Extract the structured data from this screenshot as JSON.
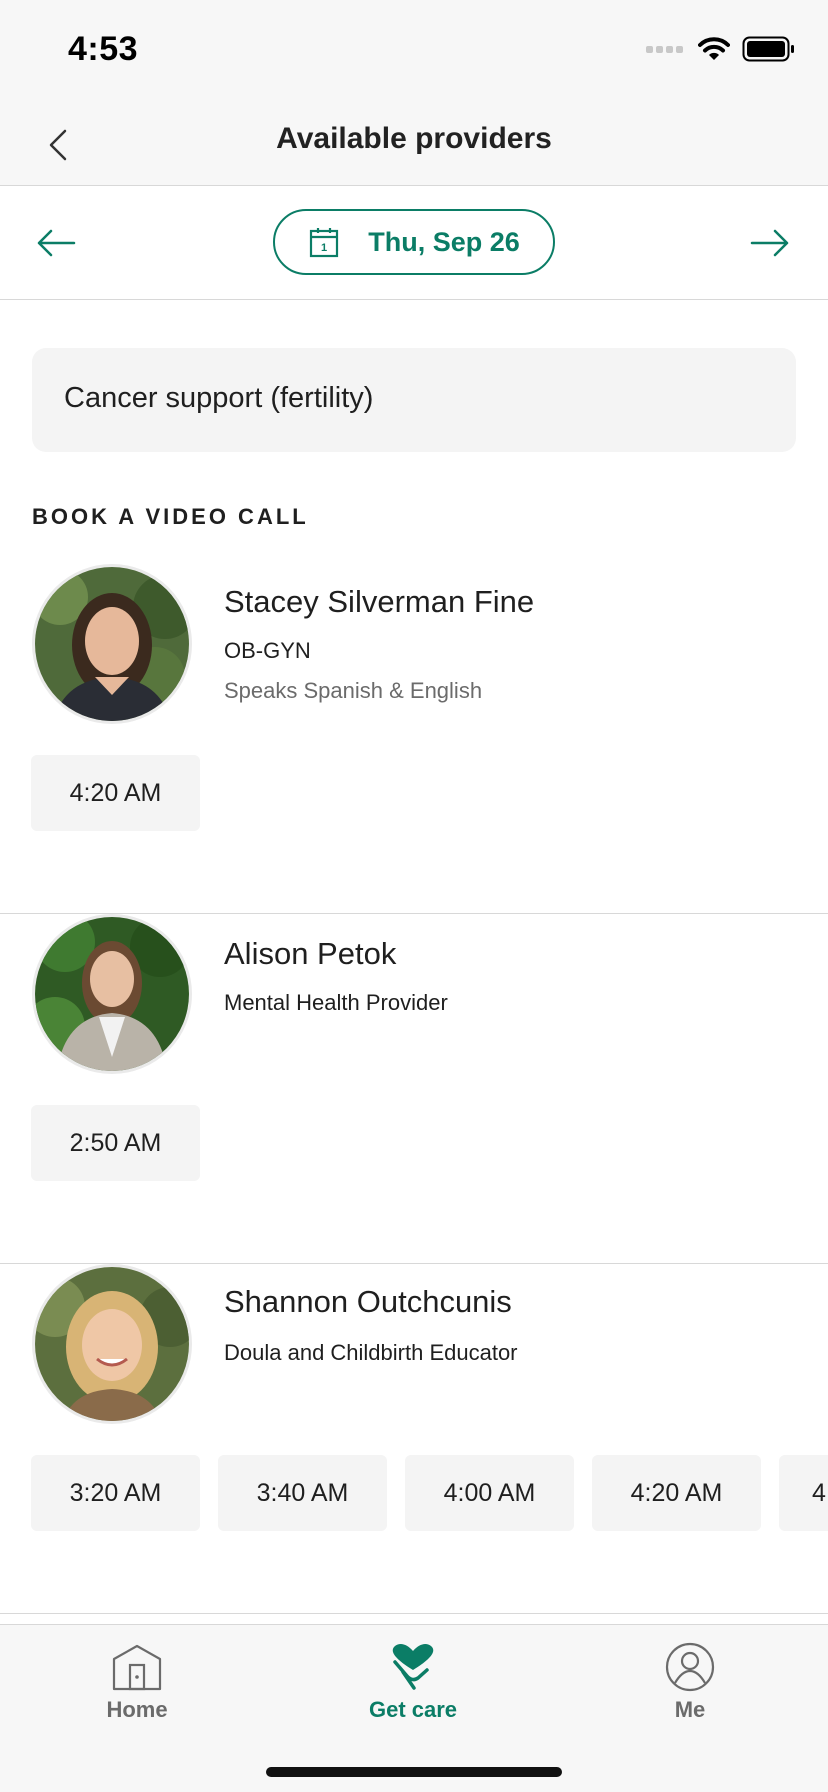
{
  "status_bar": {
    "time": "4:53"
  },
  "nav": {
    "title": "Available providers"
  },
  "date_bar": {
    "date": "Thu, Sep 26",
    "calendar_day": "1"
  },
  "concern": {
    "label": "Cancer support (fertility)"
  },
  "section": {
    "title": "BOOK A VIDEO CALL"
  },
  "providers": [
    {
      "name": "Stacey Silverman Fine",
      "role": "OB-GYN",
      "language": "Speaks Spanish & English",
      "slots": [
        "4:20 AM"
      ]
    },
    {
      "name": "Alison Petok",
      "role": "Mental Health Provider",
      "slots": [
        "2:50 AM"
      ]
    },
    {
      "name": "Shannon Outchcunis",
      "role": "Doula and Childbirth Educator",
      "slots": [
        "3:20 AM",
        "3:40 AM",
        "4:00 AM",
        "4:20 AM",
        "4"
      ]
    }
  ],
  "tab_bar": {
    "tabs": [
      {
        "label": "Home",
        "icon": "home-icon"
      },
      {
        "label": "Get care",
        "icon": "heart-hand-icon"
      },
      {
        "label": "Me",
        "icon": "user-icon"
      }
    ]
  },
  "colors": {
    "accent": "#0b7d66",
    "muted": "#6b6b6b",
    "surface": "#f4f4f4"
  }
}
